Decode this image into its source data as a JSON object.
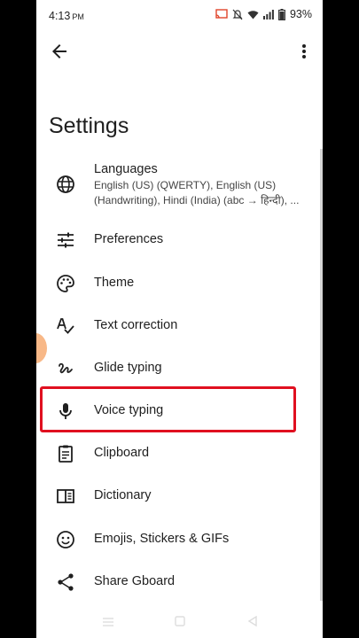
{
  "status_bar": {
    "time": "4:13",
    "ampm": "PM",
    "battery": "93%"
  },
  "page_title": "Settings",
  "items": [
    {
      "label": "Languages",
      "sub": "English (US) (QWERTY), English (US) (Handwriting), Hindi (India) (abc → हिन्दी), ...",
      "icon": "globe-icon"
    },
    {
      "label": "Preferences",
      "icon": "sliders-icon"
    },
    {
      "label": "Theme",
      "icon": "palette-icon"
    },
    {
      "label": "Text correction",
      "icon": "spellcheck-icon"
    },
    {
      "label": "Glide typing",
      "icon": "glide-icon"
    },
    {
      "label": "Voice typing",
      "icon": "mic-icon"
    },
    {
      "label": "Clipboard",
      "icon": "clipboard-icon"
    },
    {
      "label": "Dictionary",
      "icon": "book-icon"
    },
    {
      "label": "Emojis, Stickers & GIFs",
      "icon": "emoji-icon"
    },
    {
      "label": "Share Gboard",
      "icon": "share-icon"
    }
  ],
  "highlight_color": "#e01020"
}
